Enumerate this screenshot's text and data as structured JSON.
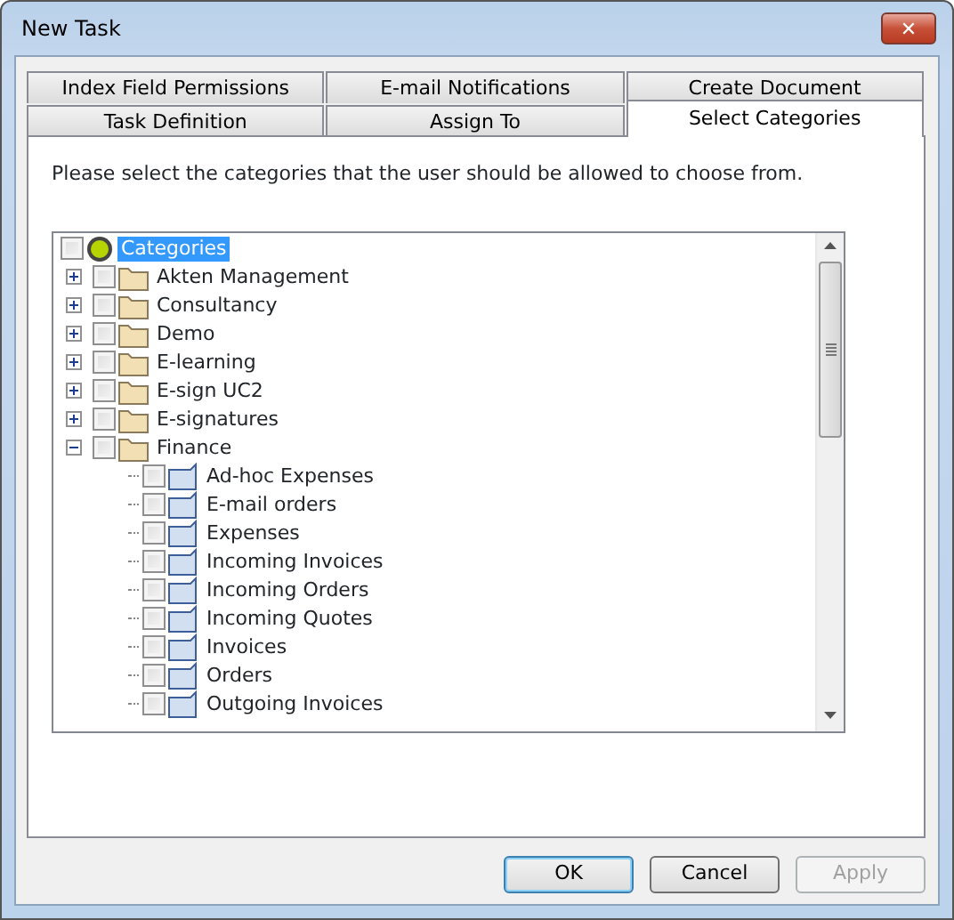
{
  "window": {
    "title": "New Task",
    "close": "✕"
  },
  "tab_rows": [
    [
      {
        "label": "Index Field Permissions",
        "selected": false
      },
      {
        "label": "E-mail Notifications",
        "selected": false
      },
      {
        "label": "Create Document",
        "selected": false
      }
    ],
    [
      {
        "label": "Task Definition",
        "selected": false
      },
      {
        "label": "Assign To",
        "selected": false
      },
      {
        "label": "Select Categories",
        "selected": true
      }
    ]
  ],
  "instruction": "Please select the categories that the user should be allowed to choose from.",
  "tree": [
    {
      "label": "Categories",
      "kind": "root",
      "selected": true,
      "checked": false,
      "children": [
        {
          "label": "Akten Management",
          "kind": "folder",
          "selected": false,
          "checked": false,
          "expanded": false
        },
        {
          "label": "Consultancy",
          "kind": "folder",
          "selected": false,
          "checked": false,
          "expanded": false
        },
        {
          "label": "Demo",
          "kind": "folder",
          "selected": false,
          "checked": false,
          "expanded": false
        },
        {
          "label": "E-learning",
          "kind": "folder",
          "selected": false,
          "checked": false,
          "expanded": false
        },
        {
          "label": "E-sign UC2",
          "kind": "folder",
          "selected": false,
          "checked": false,
          "expanded": false
        },
        {
          "label": "E-signatures",
          "kind": "folder",
          "selected": false,
          "checked": false,
          "expanded": false
        },
        {
          "label": "Finance",
          "kind": "folder",
          "selected": false,
          "checked": false,
          "expanded": true,
          "children": [
            {
              "label": "Ad-hoc Expenses",
              "kind": "category",
              "selected": false,
              "checked": false
            },
            {
              "label": "E-mail orders",
              "kind": "category",
              "selected": false,
              "checked": false
            },
            {
              "label": "Expenses",
              "kind": "category",
              "selected": false,
              "checked": false
            },
            {
              "label": "Incoming Invoices",
              "kind": "category",
              "selected": false,
              "checked": false
            },
            {
              "label": "Incoming Orders",
              "kind": "category",
              "selected": false,
              "checked": false
            },
            {
              "label": "Incoming Quotes",
              "kind": "category",
              "selected": false,
              "checked": false
            },
            {
              "label": "Invoices",
              "kind": "category",
              "selected": false,
              "checked": false
            },
            {
              "label": "Orders",
              "kind": "category",
              "selected": false,
              "checked": false
            },
            {
              "label": "Outgoing Invoices",
              "kind": "category",
              "selected": false,
              "checked": false
            }
          ]
        }
      ]
    }
  ],
  "buttons": [
    {
      "label": "OK",
      "default": true,
      "disabled": false
    },
    {
      "label": "Cancel",
      "default": false,
      "disabled": false
    },
    {
      "label": "Apply",
      "default": false,
      "disabled": true
    }
  ]
}
